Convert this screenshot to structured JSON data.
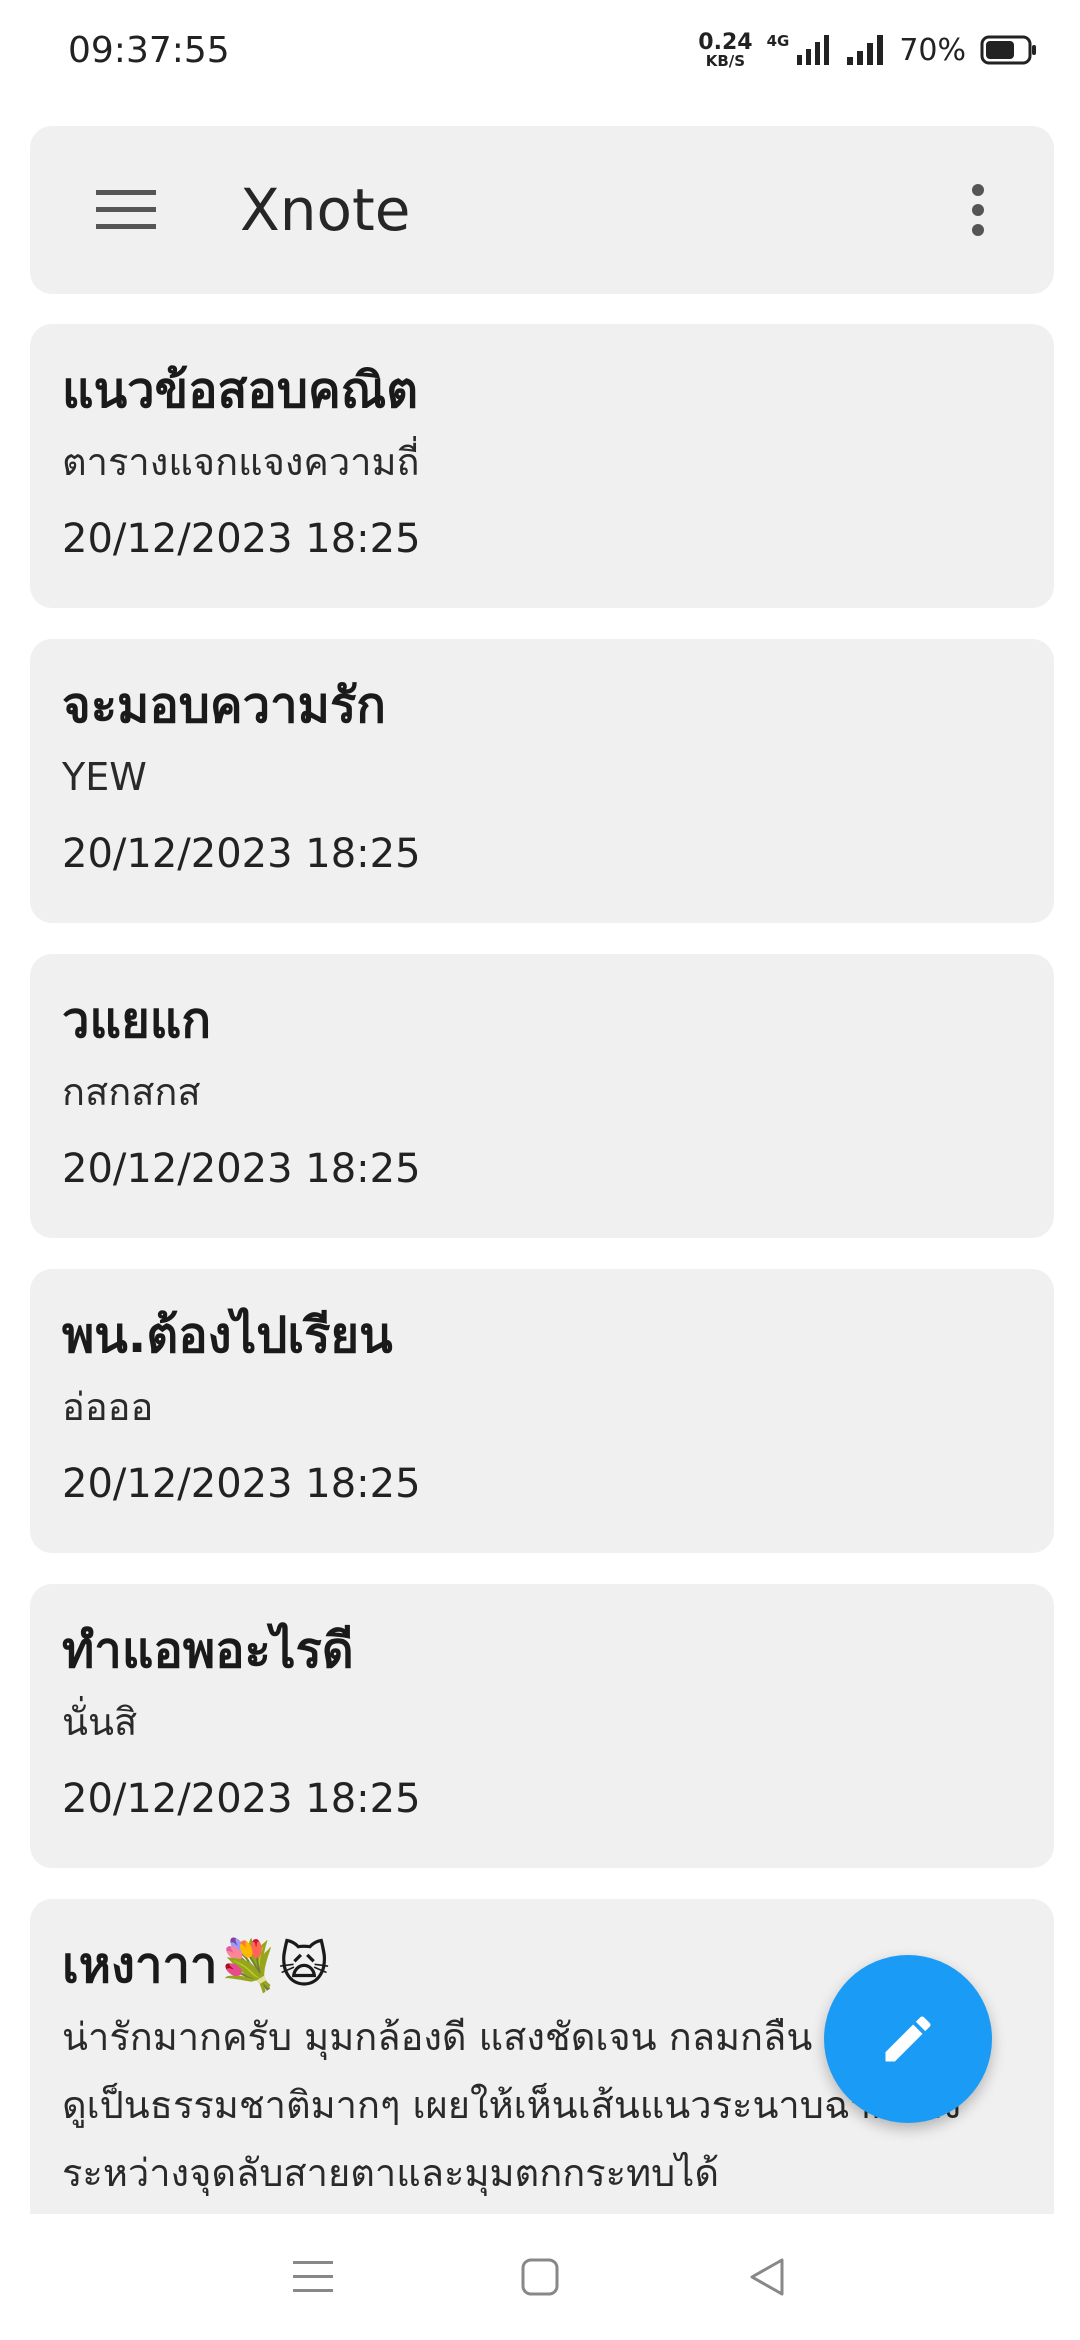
{
  "status_bar": {
    "time": "09:37:55",
    "net_speed_value": "0.24",
    "net_speed_unit": "KB/S",
    "network_type": "4G",
    "battery_percent": "70%",
    "battery_level": 0.7
  },
  "app_bar": {
    "title": "Xnote",
    "menu_icon": "hamburger-menu-icon",
    "more_icon": "more-vert-icon"
  },
  "notes": [
    {
      "title": "แนวข้อสอบคณิต",
      "body": "ตารางแจกแจงความถี่",
      "date": "20/12/2023 18:25"
    },
    {
      "title": "จะมอบความรัก",
      "body": "YEW",
      "date": "20/12/2023 18:25"
    },
    {
      "title": "วแยแก",
      "body": "กสกสกส",
      "date": "20/12/2023 18:25"
    },
    {
      "title": "พน.ต้องไปเรียน",
      "body": "อ่อออ",
      "date": "20/12/2023 18:25"
    },
    {
      "title": "ทำแอพอะไรดี",
      "body": "นั่นสิ",
      "date": "20/12/2023 18:25"
    },
    {
      "title": "เหงาาา💐🙀",
      "body_lines": [
        "น่ารักมากครับ มุมกล้องดี แสงชัดเจน กลมกลืน",
        "ดูเป็นธรรมชาติมากๆ เผยให้เห็นเส้นแนวระนาบฉากหลัง",
        "ระหว่างจุดลับสายตาและมุมตกกระทบได้"
      ]
    }
  ],
  "fab": {
    "icon": "edit-pencil-icon",
    "color": "#1a9bf5"
  },
  "nav_bar": {
    "icons": [
      "recent-apps-icon",
      "home-icon",
      "back-icon"
    ]
  }
}
